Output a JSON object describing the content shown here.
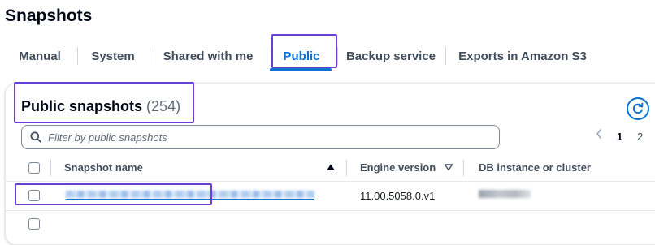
{
  "page": {
    "title": "Snapshots"
  },
  "tabs": [
    {
      "label": "Manual",
      "active": false
    },
    {
      "label": "System",
      "active": false
    },
    {
      "label": "Shared with me",
      "active": false
    },
    {
      "label": "Public",
      "active": true
    },
    {
      "label": "Backup service",
      "active": false
    },
    {
      "label": "Exports in Amazon S3",
      "active": false
    }
  ],
  "container": {
    "title": "Public snapshots",
    "count": "(254)",
    "refresh_icon": "refresh-icon"
  },
  "search": {
    "placeholder": "Filter by public snapshots",
    "value": "",
    "icon": "search-icon"
  },
  "pagination": {
    "prev_icon": "chevron-left-icon",
    "pages": [
      "1",
      "2"
    ],
    "current": "1"
  },
  "table": {
    "columns": [
      {
        "label": "Snapshot name",
        "sort": "ascending"
      },
      {
        "label": "Engine version",
        "sort": "sortable"
      },
      {
        "label": "DB instance or cluster"
      }
    ],
    "rows": [
      {
        "snapshot_name": "[redacted]",
        "engine_version": "11.00.5058.0.v1",
        "db_instance": "[redacted]"
      }
    ]
  },
  "colors": {
    "accent": "#0972d3",
    "highlight_box": "#6b3fd4",
    "text_primary": "#000716",
    "text_secondary": "#414d5c"
  }
}
